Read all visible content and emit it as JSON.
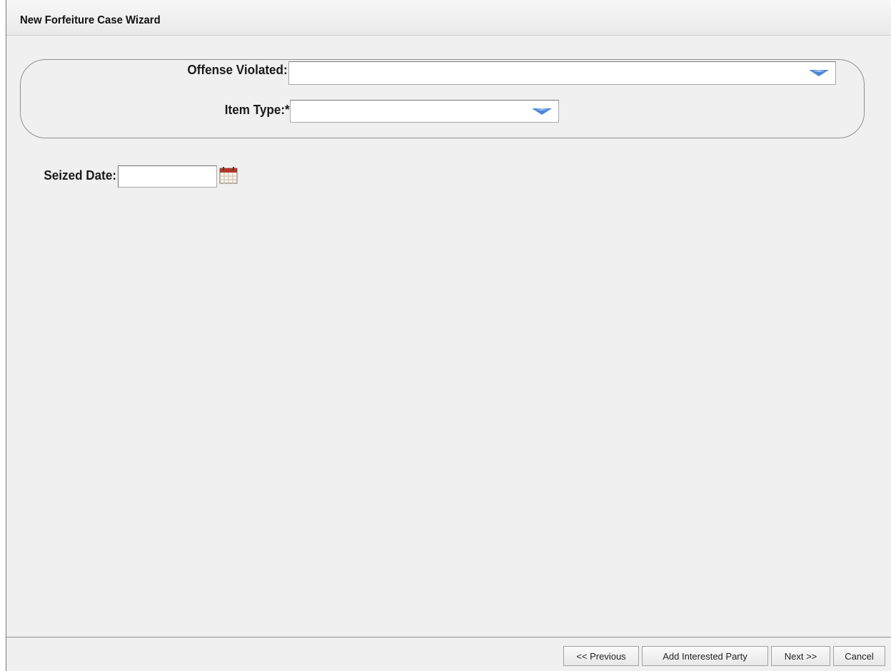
{
  "window": {
    "title": "New Forfeiture Case Wizard"
  },
  "form": {
    "offense_label": "Offense Violated:",
    "offense_value": "",
    "item_type_label": "Item Type:*",
    "item_type_value": "",
    "seized_date_label": "Seized Date:",
    "seized_date_value": ""
  },
  "buttons": {
    "previous": "<< Previous",
    "add_party": "Add Interested Party",
    "next": "Next >>",
    "cancel": "Cancel"
  },
  "icons": {
    "dropdown": "chevron-down-icon",
    "calendar": "calendar-icon"
  },
  "colors": {
    "dropdown_arrow": "#4a87d6",
    "calendar_header": "#b3382c"
  }
}
